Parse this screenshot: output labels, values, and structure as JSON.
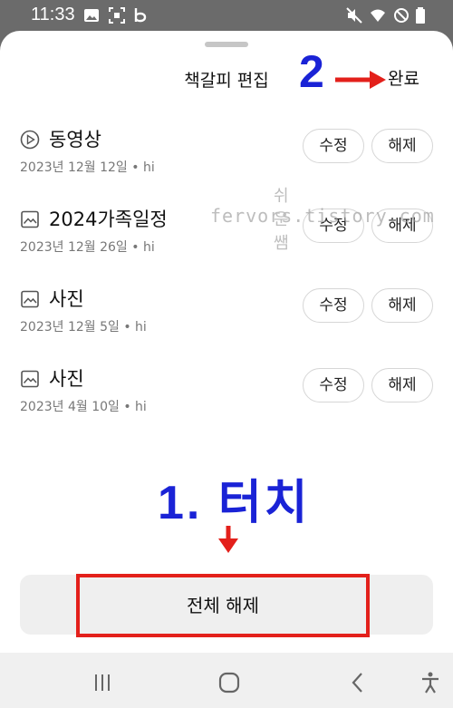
{
  "status_bar": {
    "time": "11:33",
    "icons": [
      "gallery-icon",
      "screenshot-icon",
      "bixby-icon",
      "mute-icon",
      "wifi-icon",
      "do-not-disturb-icon",
      "battery-icon"
    ]
  },
  "sheet": {
    "title": "책갈피 편집",
    "done_label": "완료"
  },
  "items": [
    {
      "icon": "video-play-icon",
      "title": "동영상",
      "subtitle": "2023년 12월 12일 • hi",
      "edit_label": "수정",
      "remove_label": "해제"
    },
    {
      "icon": "image-icon",
      "title": "2024가족일정",
      "subtitle": "2023년 12월 26일 • hi",
      "edit_label": "수정",
      "remove_label": "해제"
    },
    {
      "icon": "image-icon",
      "title": "사진",
      "subtitle": "2023년 12월 5일 • hi",
      "edit_label": "수정",
      "remove_label": "해제"
    },
    {
      "icon": "image-icon",
      "title": "사진",
      "subtitle": "2023년 4월 10일 • hi",
      "edit_label": "수정",
      "remove_label": "해제"
    }
  ],
  "watermark": {
    "line1": "쉬운쌤",
    "line2": "fervors.tistory.com"
  },
  "annotations": {
    "step_two": "2",
    "step_one": "1. 터치",
    "color_blue": "#1a23d6",
    "color_red": "#e3201b"
  },
  "bottom_action": {
    "remove_all_label": "전체 해제"
  },
  "nav_bar": {
    "items": [
      "recent-apps-icon",
      "home-icon",
      "back-icon",
      "accessibility-icon"
    ]
  }
}
